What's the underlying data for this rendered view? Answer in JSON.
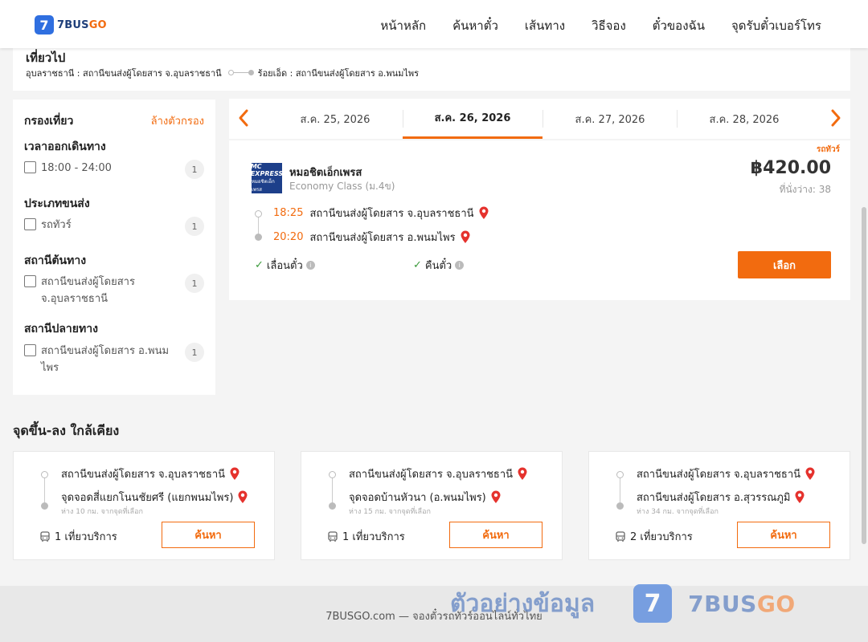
{
  "header": {
    "logo_number": "7",
    "logo_brand": "7BUS",
    "logo_brand_suffix": "GO",
    "nav": [
      "หน้าหลัก",
      "ค้นหาตั๋ว",
      "เส้นทาง",
      "วิธีจอง",
      "ตั๋วของฉัน",
      "จุดรับตั๋วเบอร์โทร"
    ]
  },
  "trip": {
    "title": "เที่ยวไป",
    "from": "อุบลราชธานี : สถานีขนส่งผู้โดยสาร จ.อุบลราชธานี",
    "to": "ร้อยเอ็ด : สถานีขนส่งผู้โดยสาร อ.พนมไพร"
  },
  "filter": {
    "title": "กรองเที่ยว",
    "clear": "ล้างตัวกรอง",
    "groups": [
      {
        "title": "เวลาออกเดินทาง",
        "options": [
          {
            "label": "18:00 - 24:00",
            "count": "1"
          }
        ]
      },
      {
        "title": "ประเภทขนส่ง",
        "options": [
          {
            "label": "รถทัวร์",
            "count": "1"
          }
        ]
      },
      {
        "title": "สถานีต้นทาง",
        "options": [
          {
            "label": "สถานีขนส่งผู้โดยสาร จ.อุบลราชธานี",
            "count": "1"
          }
        ]
      },
      {
        "title": "สถานีปลายทาง",
        "options": [
          {
            "label": "สถานีขนส่งผู้โดยสาร อ.พนมไพร",
            "count": "1"
          }
        ]
      }
    ]
  },
  "dates": {
    "tabs": [
      "ส.ค. 25, 2026",
      "ส.ค. 26, 2026",
      "ส.ค. 27, 2026",
      "ส.ค. 28, 2026"
    ],
    "active_index": 1
  },
  "result": {
    "tag": "รถทัวร์",
    "operator_logo_text": "MC EXPRESS",
    "operator_logo_sub": "หมอชิตเอ็กเพรส",
    "operator": "หมอชิตเอ็กเพรส",
    "class": "Economy Class (ม.4ข)",
    "price": "฿420.00",
    "seats": "ที่นั่งว่าง: 38",
    "depart_time": "18:25",
    "depart_station": "สถานีขนส่งผู้โดยสาร จ.อุบลราชธานี",
    "arrive_time": "20:20",
    "arrive_station": "สถานีขนส่งผู้โดยสาร อ.พนมไพร",
    "feature_1": "เลื่อนตั๋ว",
    "feature_2": "คืนตั๋ว",
    "select": "เลือก"
  },
  "nearby": {
    "title": "จุดขึ้น-ลง ใกล้เคียง",
    "cards": [
      {
        "from": "สถานีขนส่งผู้โดยสาร จ.อุบลราชธานี",
        "to": "จุดจอดสี่แยกโนนชัยศรี (แยกพนมไพร)",
        "distance": "ห่าง 10 กม. จากจุดที่เลือก",
        "trips": "1 เที่ยวบริการ",
        "button": "ค้นหา"
      },
      {
        "from": "สถานีขนส่งผู้โดยสาร จ.อุบลราชธานี",
        "to": "จุดจอดบ้านหัวนา (อ.พนมไพร)",
        "distance": "ห่าง 15 กม. จากจุดที่เลือก",
        "trips": "1 เที่ยวบริการ",
        "button": "ค้นหา"
      },
      {
        "from": "สถานีขนส่งผู้โดยสาร จ.อุบลราชธานี",
        "to": "สถานีขนส่งผู้โดยสาร อ.สุวรรณภูมิ",
        "distance": "ห่าง 34 กม. จากจุดที่เลือก",
        "trips": "2 เที่ยวบริการ",
        "button": "ค้นหา"
      }
    ]
  },
  "footer": {
    "text": "7BUSGO.com — จองตั๋วรถทัวร์ออนไลน์ทั่วไทย"
  },
  "watermark": {
    "text": "ตัวอย่างข้อมูล",
    "badge": "7",
    "brand": "7BUS",
    "brand_suffix": "GO"
  },
  "colors": {
    "accent": "#f26b0f",
    "brand_blue": "#2f6fe0",
    "pin_red": "#e5322d",
    "check_green": "#3a9a3a"
  },
  "icons": [
    "chevron-left-icon",
    "chevron-right-icon",
    "map-pin-icon",
    "check-icon",
    "info-icon",
    "bus-icon",
    "checkbox-icon"
  ]
}
